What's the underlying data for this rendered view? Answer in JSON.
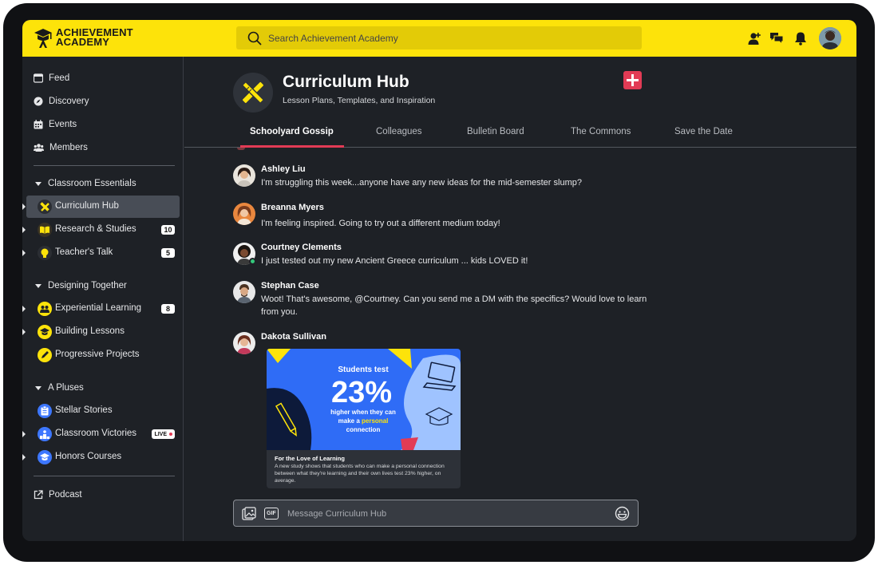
{
  "brand": {
    "name_line1": "ACHIEVEMENT",
    "name_line2": "ACADEMY",
    "accent_color": "#fde30a",
    "highlight_color": "#e23b55"
  },
  "search": {
    "placeholder": "Search Achievement Academy"
  },
  "top_actions": [
    "add-friend-icon",
    "chat-icon",
    "bell-icon",
    "user-avatar"
  ],
  "sidebar": {
    "primary": [
      {
        "label": "Feed",
        "icon": "feed-icon"
      },
      {
        "label": "Discovery",
        "icon": "compass-icon"
      },
      {
        "label": "Events",
        "icon": "calendar-icon"
      },
      {
        "label": "Members",
        "icon": "members-icon"
      }
    ],
    "sections": [
      {
        "title": "Classroom Essentials",
        "channels": [
          {
            "label": "Curriculum Hub",
            "active": true
          },
          {
            "label": "Research & Studies",
            "badge": "10"
          },
          {
            "label": "Teacher's Talk",
            "badge": "5"
          }
        ]
      },
      {
        "title": "Designing Together",
        "channels": [
          {
            "label": "Experiential Learning",
            "badge": "8"
          },
          {
            "label": "Building Lessons"
          },
          {
            "label": "Progressive Projects"
          }
        ]
      },
      {
        "title": "A Pluses",
        "channels": [
          {
            "label": "Stellar Stories"
          },
          {
            "label": "Classroom Victories",
            "badge": "LIVE"
          },
          {
            "label": "Honors Courses"
          }
        ]
      }
    ],
    "footer": {
      "label": "Podcast"
    }
  },
  "hub": {
    "title": "Curriculum Hub",
    "subtitle": "Lesson Plans, Templates, and Inspiration"
  },
  "tabs": [
    "Schoolyard Gossip",
    "Colleagues",
    "Bulletin Board",
    "The Commons",
    "Save the Date"
  ],
  "active_tab": "Schoolyard Gossip",
  "messages": [
    {
      "author": "Ashley Liu",
      "text": "I'm struggling this week...anyone have any new ideas for the mid-semester slump?"
    },
    {
      "author": "Breanna Myers",
      "text": "I'm feeling inspired. Going to try out a different medium today!"
    },
    {
      "author": "Courtney Clements",
      "text": "I just tested out my new Ancient Greece curriculum ... kids LOVED it!",
      "online": true
    },
    {
      "author": "Stephan Case",
      "text": "Woot! That's awesome, @Courtney. Can you send me a DM with the specifics? Would love to learn from you."
    },
    {
      "author": "Dakota Sullivan",
      "text": ""
    }
  ],
  "attachment": {
    "headline": "Students test",
    "stat": "23%",
    "line1": "higher when they can",
    "line2_prefix": "make a ",
    "line2_bold": "personal",
    "line3": "connection",
    "title": "For the Love of Learning",
    "body": "A new study shows that students who can make a personal connection between what they're learning and their own lives test 23% higher, on average."
  },
  "composer": {
    "placeholder": "Message Curriculum Hub",
    "gif_label": "GIF"
  }
}
